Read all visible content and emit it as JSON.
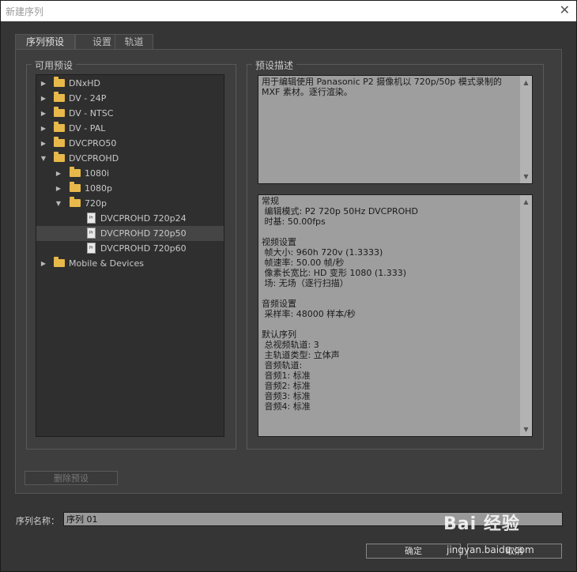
{
  "window": {
    "title": "新建序列",
    "close_glyph": "✕"
  },
  "tabs": [
    {
      "label": "序列预设"
    },
    {
      "label": "设置"
    },
    {
      "label": "轨道"
    }
  ],
  "available_presets": {
    "label": "可用预设",
    "items": [
      {
        "label": "DNxHD",
        "type": "folder",
        "level": 0,
        "expanded": false
      },
      {
        "label": "DV - 24P",
        "type": "folder",
        "level": 0,
        "expanded": false
      },
      {
        "label": "DV - NTSC",
        "type": "folder",
        "level": 0,
        "expanded": false
      },
      {
        "label": "DV - PAL",
        "type": "folder",
        "level": 0,
        "expanded": false
      },
      {
        "label": "DVCPRO50",
        "type": "folder",
        "level": 0,
        "expanded": false
      },
      {
        "label": "DVCPROHD",
        "type": "folder",
        "level": 0,
        "expanded": true
      },
      {
        "label": "1080i",
        "type": "folder",
        "level": 1,
        "expanded": false
      },
      {
        "label": "1080p",
        "type": "folder",
        "level": 1,
        "expanded": false
      },
      {
        "label": "720p",
        "type": "folder",
        "level": 1,
        "expanded": true
      },
      {
        "label": "DVCPROHD 720p24",
        "type": "preset",
        "level": 2
      },
      {
        "label": "DVCPROHD 720p50",
        "type": "preset",
        "level": 2,
        "selected": true
      },
      {
        "label": "DVCPROHD 720p60",
        "type": "preset",
        "level": 2
      },
      {
        "label": "Mobile & Devices",
        "type": "folder",
        "level": 0,
        "expanded": false
      }
    ],
    "file_icon_text": "Pr"
  },
  "preset_description": {
    "label": "预设描述",
    "summary": "用于编辑使用 Panasonic P2 摄像机以 720p/50p 模式录制的\nMXF 素材。逐行渲染。",
    "details": "常规\n 编辑模式: P2 720p 50Hz DVCPROHD\n 时基: 50.00fps\n\n视频设置\n 帧大小: 960h 720v (1.3333)\n 帧速率: 50.00 帧/秒\n 像素长宽比: HD 变形 1080 (1.333)\n 场: 无场（逐行扫描）\n\n音频设置\n 采样率: 48000 样本/秒\n\n默认序列\n 总视频轨道: 3\n 主轨道类型: 立体声\n 音频轨道:\n 音频1: 标准\n 音频2: 标准\n 音频3: 标准\n 音频4: 标准"
  },
  "buttons": {
    "delete_preset": "删除预设",
    "ok": "确定",
    "cancel": "取消"
  },
  "sequence_name": {
    "label": "序列名称：",
    "value": "序列 01"
  },
  "watermark": {
    "brand": "Bai 经验",
    "url": "jingyan.baidu.com"
  },
  "colors": {
    "folder": "#e8b94a",
    "selected_row": "#454545",
    "description_bg": "#9e9e9e"
  }
}
